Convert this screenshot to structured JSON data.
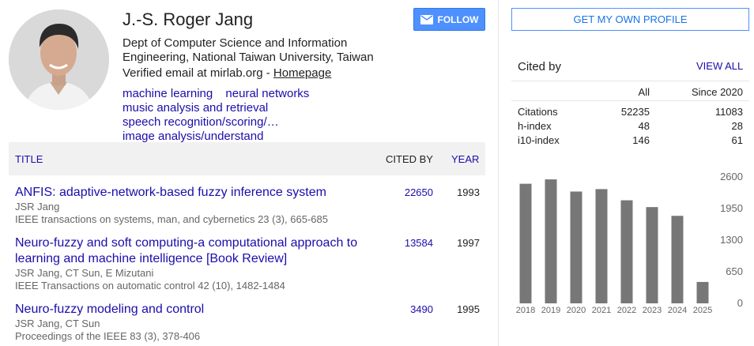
{
  "profile": {
    "name": "J.-S. Roger Jang",
    "affiliation": "Dept of Computer Science and Information Engineering, National Taiwan University, Taiwan",
    "email": "Verified email at mirlab.org - ",
    "homepage": "Homepage",
    "interests": [
      "machine learning",
      "neural networks",
      "music analysis and retrieval",
      "speech recognition/scoring/…",
      "image analysis/understand"
    ],
    "follow_label": "FOLLOW"
  },
  "table": {
    "title_header": "TITLE",
    "cited_header": "CITED BY",
    "year_header": "YEAR",
    "rows": [
      {
        "title": "ANFIS: adaptive-network-based fuzzy inference system",
        "authors": "JSR Jang",
        "venue": "IEEE transactions on systems, man, and cybernetics 23 (3), 665-685",
        "cites": "22650",
        "year": "1993"
      },
      {
        "title": "Neuro-fuzzy and soft computing-a computational approach to learning and machine intelligence [Book Review]",
        "authors": "JSR Jang, CT Sun, E Mizutani",
        "venue": "IEEE Transactions on automatic control 42 (10), 1482-1484",
        "cites": "13584",
        "year": "1997"
      },
      {
        "title": "Neuro-fuzzy modeling and control",
        "authors": "JSR Jang, CT Sun",
        "venue": "Proceedings of the IEEE 83 (3), 378-406",
        "cites": "3490",
        "year": "1995"
      }
    ]
  },
  "sidebar": {
    "my_profile_label": "GET MY OWN PROFILE",
    "cited_by_label": "Cited by",
    "view_all_label": "VIEW ALL",
    "col_all": "All",
    "col_since": "Since 2020",
    "stats": [
      {
        "label": "Citations",
        "all": "52235",
        "since": "11083"
      },
      {
        "label": "h-index",
        "all": "48",
        "since": "28"
      },
      {
        "label": "i10-index",
        "all": "146",
        "since": "61"
      }
    ]
  },
  "chart_data": {
    "type": "bar",
    "categories": [
      "2018",
      "2019",
      "2020",
      "2021",
      "2022",
      "2023",
      "2024",
      "2025"
    ],
    "values": [
      2460,
      2550,
      2300,
      2350,
      2120,
      1980,
      1800,
      440
    ],
    "ylim": [
      0,
      2600
    ],
    "yticks": [
      "2600",
      "1950",
      "1300",
      "650",
      "0"
    ],
    "bar_color": "#777777"
  },
  "colors": {
    "link": "#1a0dab",
    "button": "#4d90fe"
  }
}
